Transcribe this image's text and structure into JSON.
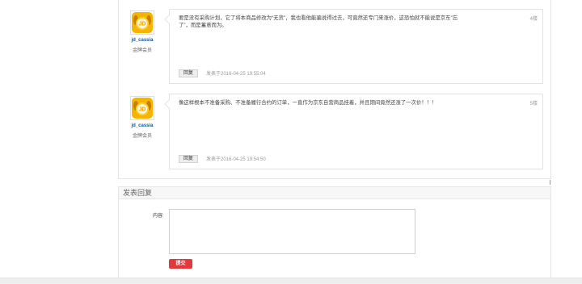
{
  "posts": [
    {
      "author": "jd_cassia",
      "rank": "金牌会员",
      "text": "要是没有采购计划，它了将本商品修改为“无货”，我也看他能骗说得过去，可竟然还专门来涨价，这恐怕就不能说是京东“忘了”，而是蓄意而为。",
      "floor": "4楼",
      "reply_label": "回复",
      "time": "发表于2016-04-25 19:55:04"
    },
    {
      "author": "jd_cassia",
      "rank": "金牌会员",
      "text": "像这样根本不准备采购、不准备履行合约的订单，一直作为京东自营商品挂着，并且期间竟然还涨了一次价！！！",
      "floor": "5楼",
      "reply_label": "回复",
      "time": "发表于2016-04-25 19:54:50"
    }
  ],
  "reply_form": {
    "title": "发表回复",
    "content_label": "内容:",
    "textarea_value": "",
    "submit_label": "提交"
  },
  "colors": {
    "accent": "#e4393c",
    "author_link": "#0a5ba6",
    "avatar_yellow": "#f5b400"
  },
  "icons": {
    "avatar": "jd-dog-avatar-icon",
    "resize": "resize-grip-icon"
  }
}
